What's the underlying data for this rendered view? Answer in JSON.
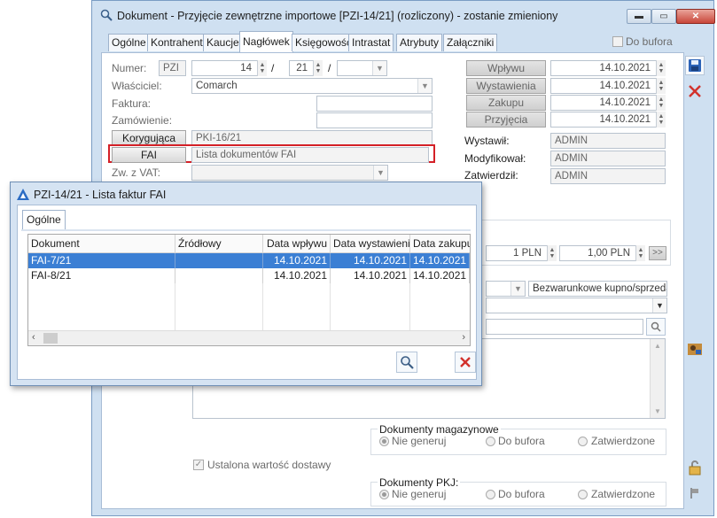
{
  "main": {
    "title": "Dokument - Przyjęcie zewnętrzne importowe [PZI-14/21] (rozliczony) - zostanie zmieniony",
    "tabs": [
      "Ogólne",
      "Kontrahent",
      "Kaucje",
      "Nagłówek",
      "Księgowość",
      "Intrastat",
      "Atrybuty",
      "Załączniki"
    ],
    "active_tab": "Nagłówek",
    "do_bufora_label": "Do bufora",
    "form": {
      "numer_label": "Numer:",
      "numer_prefix": "PZI",
      "numer_value": "14",
      "numer_sep1": "/",
      "numer_year": "21",
      "numer_sep2": "/",
      "wlasciciel_label": "Właściciel:",
      "wlasciciel_value": "Comarch",
      "faktura_label": "Faktura:",
      "zamowienie_label": "Zamówienie:",
      "korygujaca_label": "Korygująca",
      "korygujaca_value": "PKI-16/21",
      "fai_label": "FAI",
      "fai_value": "Lista dokumentów FAI",
      "zw_vat_label": "Zw. z VAT:"
    },
    "dates": {
      "wplywu_label": "Wpływu",
      "wplywu_value": "14.10.2021",
      "wystawienia_label": "Wystawienia",
      "wystawienia_value": "14.10.2021",
      "zakupu_label": "Zakupu",
      "zakupu_value": "14.10.2021",
      "przyjecia_label": "Przyjęcia",
      "przyjecia_value": "14.10.2021"
    },
    "people": {
      "wystawil_label": "Wystawił:",
      "wystawil_value": "ADMIN",
      "modyfikowal_label": "Modyfikował:",
      "modyfikowal_value": "ADMIN",
      "zatwierdzil_label": "Zatwierdził:",
      "zatwierdzil_value": "ADMIN"
    },
    "rate": {
      "value1": "1 PLN",
      "value2": "1,00 PLN",
      "go": ">>"
    },
    "payment_terms": "Bezwarunkowe kupno/sprzedaż",
    "dok_magazynowe": {
      "label": "Dokumenty magazynowe",
      "options": [
        "Nie generuj",
        "Do bufora",
        "Zatwierdzone"
      ],
      "selected": "Nie generuj"
    },
    "ustalona_label": "Ustalona wartość dostawy",
    "dok_pkj": {
      "label": "Dokumenty PKJ:",
      "options": [
        "Nie generuj",
        "Do bufora",
        "Zatwierdzone"
      ],
      "selected": "Nie generuj"
    }
  },
  "dialog": {
    "title": "PZI-14/21 - Lista faktur FAI",
    "tab": "Ogólne",
    "columns": [
      "Dokument",
      "Źródłowy",
      "Data wpływu",
      "Data wystawienia",
      "Data zakupu"
    ],
    "rows": [
      [
        "FAI-7/21",
        "",
        "14.10.2021",
        "14.10.2021",
        "14.10.2021"
      ],
      [
        "FAI-8/21",
        "",
        "14.10.2021",
        "14.10.2021",
        "14.10.2021"
      ]
    ],
    "selected_row": 0
  },
  "colors": {
    "selection": "#3b7fd4",
    "highlight_border": "#d42027",
    "window_bg": "#cfe0f1",
    "close_red": "#d2322d"
  }
}
